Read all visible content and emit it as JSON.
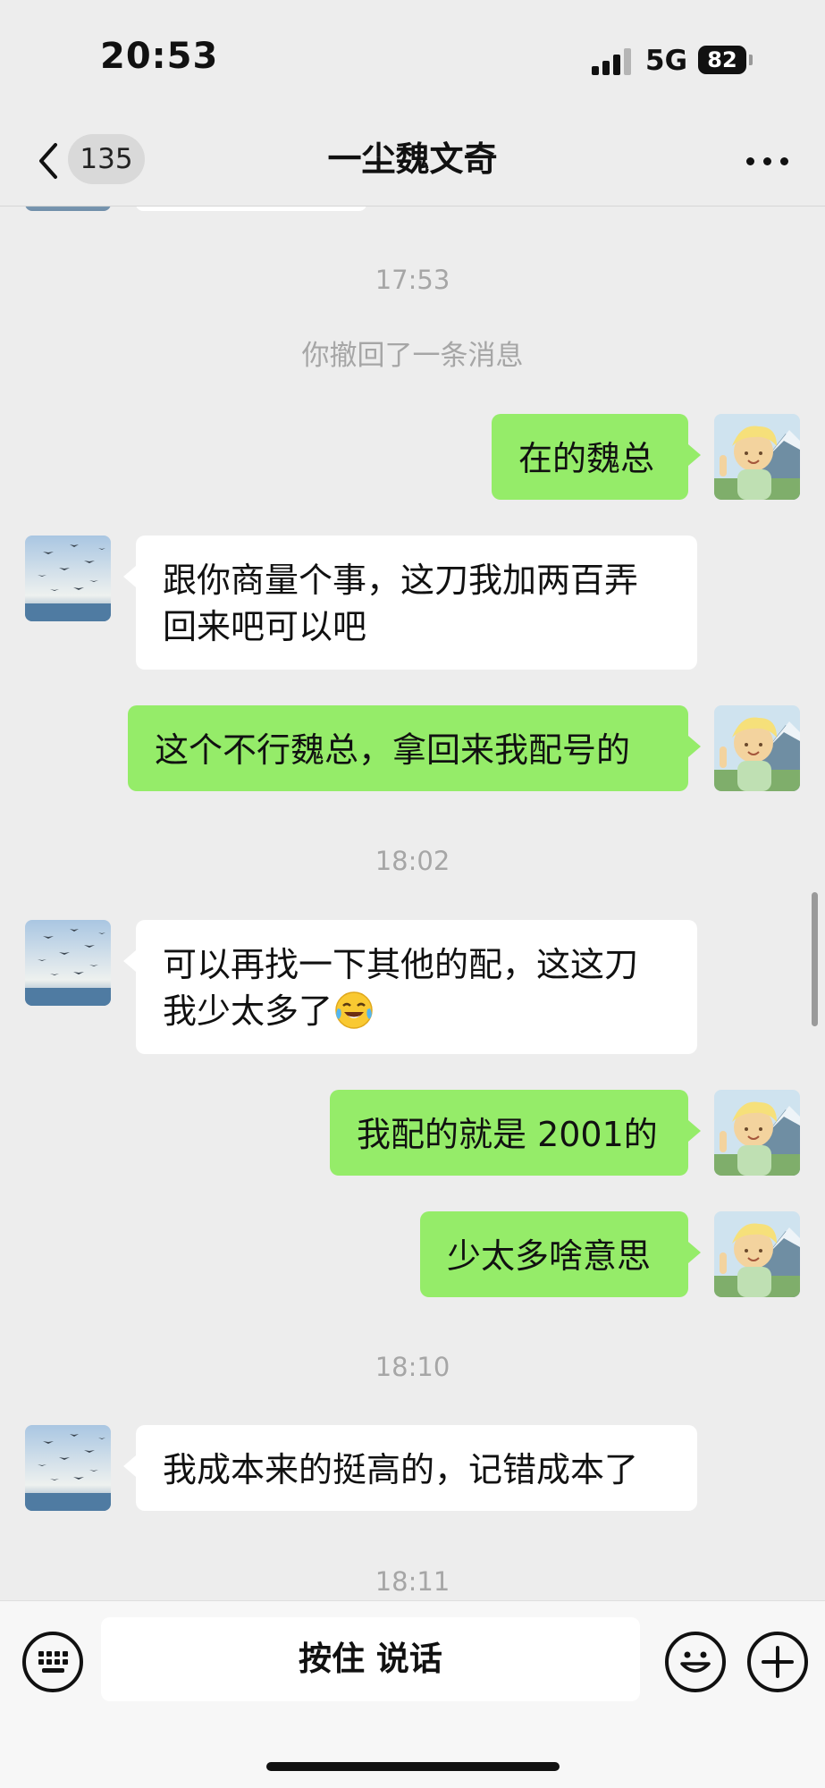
{
  "status_bar": {
    "time": "20:53",
    "network": "5G",
    "battery": "82"
  },
  "header": {
    "unread_count": "135",
    "title": "一尘魏文奇"
  },
  "messages": [
    {
      "kind": "timestamp",
      "text": "17:53"
    },
    {
      "kind": "system",
      "text": "你撤回了一条消息"
    },
    {
      "kind": "sent",
      "text": "在的魏总"
    },
    {
      "kind": "received",
      "text": "跟你商量个事，这刀我加两百弄回来吧可以吧"
    },
    {
      "kind": "sent",
      "text": "这个不行魏总，拿回来我配号的"
    },
    {
      "kind": "timestamp",
      "text": "18:02"
    },
    {
      "kind": "received",
      "text": "可以再找一下其他的配，这这刀我少太多了",
      "emoji": "crying-laughing-emoji"
    },
    {
      "kind": "sent",
      "text": "我配的就是 2001的"
    },
    {
      "kind": "sent",
      "text": "少太多啥意思"
    },
    {
      "kind": "timestamp",
      "text": "18:10"
    },
    {
      "kind": "received",
      "text": "我成本来的挺高的，记错成本了"
    },
    {
      "kind": "timestamp",
      "text": "18:11"
    }
  ],
  "input_bar": {
    "hold_to_talk_label": "按住 说话",
    "left_icon": "keyboard-icon",
    "right_icons": [
      "emoji-icon",
      "plus-icon"
    ]
  },
  "colors": {
    "background": "#ededed",
    "sent_bubble": "#95ec69",
    "received_bubble": "#ffffff",
    "timestamp_text": "#a6a6a6"
  }
}
